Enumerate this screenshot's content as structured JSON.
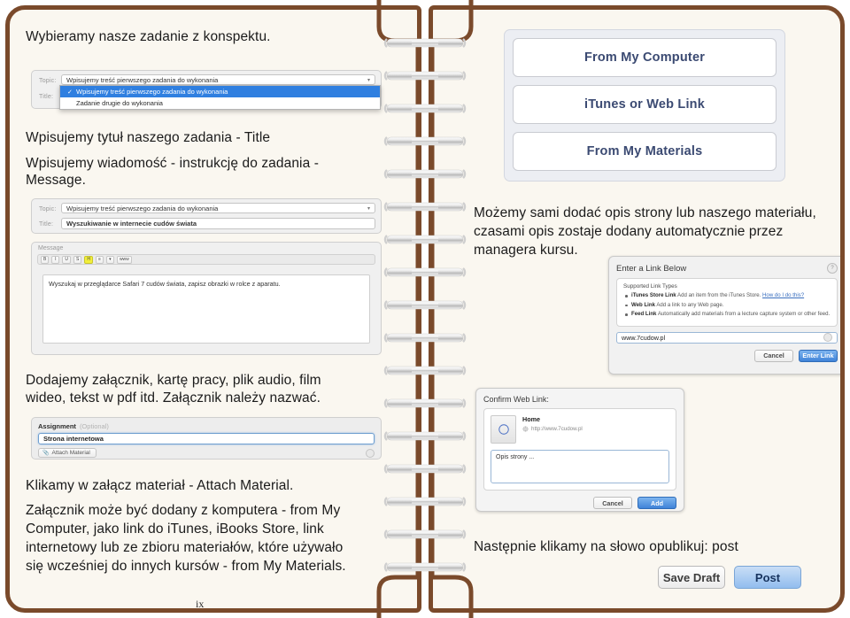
{
  "document": {
    "page_number": "ix",
    "language": "pl"
  },
  "left_page": {
    "paragraphs": [
      {
        "id": "p1",
        "text": "Wybieramy nasze zadanie z konspektu."
      },
      {
        "id": "p2",
        "text": "Wpisujemy tytuł naszego zadania - Title"
      },
      {
        "id": "p3_line1",
        "text": "Wpisujemy wiadomość - instrukcję do zadania -"
      },
      {
        "id": "p3_line2",
        "text": "Message."
      },
      {
        "id": "p4_line1",
        "text": "Dodajemy załącznik, kartę pracy, plik audio, film"
      },
      {
        "id": "p4_line2",
        "text": "wideo, tekst w pdf itd. Załącznik należy nazwać."
      },
      {
        "id": "p5",
        "text": "Klikamy w załącz materiał - Attach Material."
      },
      {
        "id": "p6_line1",
        "text": "Załącznik może być dodany z komputera - from My"
      },
      {
        "id": "p6_line2",
        "text": "Computer, jako link do iTunes, iBooks Store, link"
      },
      {
        "id": "p6_line3",
        "text": "internetowy lub ze zbioru materiałów, które używało"
      },
      {
        "id": "p6_line4",
        "text": "się wcześniej do innych kursów - from My Materials."
      }
    ],
    "topic_dropdown_shot": {
      "topic_label": "Topic:",
      "topic_value": "Wpisujemy treść pierwszego zadania do wykonania",
      "title_label": "Title:",
      "menu_options": [
        {
          "label": "Wpisujemy treść pierwszego zadania do wykonania",
          "selected": true,
          "check": "✓"
        },
        {
          "label": "Zadanie drugie do wykonania",
          "selected": false,
          "check": ""
        }
      ]
    },
    "topic_title_shot": {
      "topic_label": "Topic:",
      "topic_value": "Wpisujemy treść pierwszego zadania do wykonania",
      "title_label": "Title:",
      "title_value": "Wyszukiwanie w internecie cudów świata"
    },
    "message_shot": {
      "caption": "Message",
      "toolbar_buttons": [
        "B",
        "I",
        "U",
        "S",
        "H",
        "⋮≡",
        "▾",
        "www"
      ],
      "body_text": "Wyszukaj w przeglądarce Safari 7 cudów świata, zapisz obrazki w rolce z aparatu."
    },
    "assignment_shot": {
      "heading": "Assignment",
      "optional_label": "(Optional)",
      "input_value": "Strona internetowa",
      "attach_button": "Attach Material"
    }
  },
  "right_page": {
    "paragraphs": [
      {
        "id": "r1_line1",
        "text": "Możemy sami dodać opis strony lub naszego materiału,"
      },
      {
        "id": "r1_line2",
        "text": "czasami opis zostaje dodany automatycznie przez"
      },
      {
        "id": "r1_line3",
        "text": "managera kursu."
      },
      {
        "id": "r2",
        "text": "Następnie klikamy na słowo opublikuj: post"
      }
    ],
    "source_chooser": {
      "buttons": [
        "From My Computer",
        "iTunes or Web Link",
        "From My Materials"
      ],
      "text_color": "#3b4a72"
    },
    "enter_link_dialog": {
      "title": "Enter a Link Below",
      "help_glyph": "?",
      "supported_heading": "Supported Link Types",
      "link_types": [
        {
          "name": "iTunes Store Link",
          "desc": "Add an item from the iTunes Store.",
          "link": "How do I do this?"
        },
        {
          "name": "Web Link",
          "desc": "Add a link to any Web page.",
          "link": ""
        },
        {
          "name": "Feed Link",
          "desc": "Automatically add materials from a lecture capture system or other feed.",
          "link": ""
        }
      ],
      "url_value": "www.7cudow.pl",
      "cancel_label": "Cancel",
      "confirm_label": "Enter Link"
    },
    "confirm_link_dialog": {
      "title": "Confirm Web Link:",
      "item_name": "Home",
      "item_url": "http://www.7cudow.pl",
      "description_value": "Opis strony ...",
      "cancel_label": "Cancel",
      "add_label": "Add"
    },
    "post_actions": {
      "save_draft_label": "Save Draft",
      "post_label": "Post"
    }
  },
  "colors": {
    "page_background": "#faf7f0",
    "binder_brown": "#7a4a2b",
    "selection_blue": "#2f7fe0",
    "highlight_yellow": "#f2ef3a"
  }
}
